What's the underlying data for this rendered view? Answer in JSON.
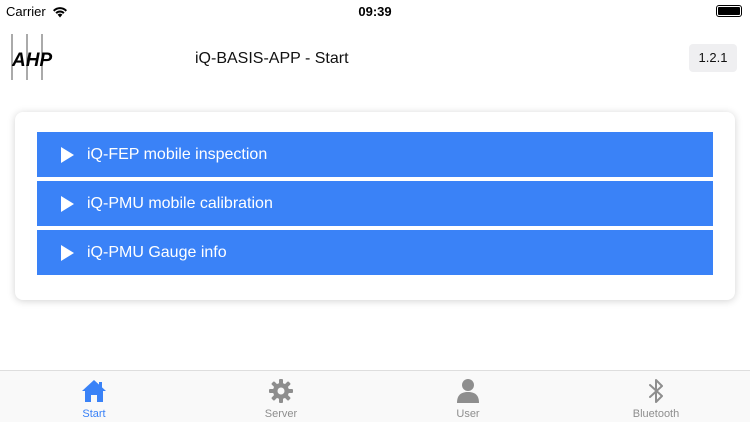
{
  "status": {
    "carrier": "Carrier",
    "time": "09:39"
  },
  "header": {
    "logo_text": "AHP",
    "title": "iQ-BASIS-APP - Start",
    "version": "1.2.1"
  },
  "menu": {
    "items": [
      {
        "label": "iQ-FEP mobile inspection"
      },
      {
        "label": "iQ-PMU mobile calibration"
      },
      {
        "label": "iQ-PMU Gauge info"
      }
    ]
  },
  "tabs": [
    {
      "label": "Start",
      "icon": "home-icon",
      "active": true
    },
    {
      "label": "Server",
      "icon": "gear-icon",
      "active": false
    },
    {
      "label": "User",
      "icon": "user-icon",
      "active": false
    },
    {
      "label": "Bluetooth",
      "icon": "bluetooth-icon",
      "active": false
    }
  ],
  "colors": {
    "accent": "#3a82f7",
    "tab_inactive": "#8e8e8e"
  }
}
